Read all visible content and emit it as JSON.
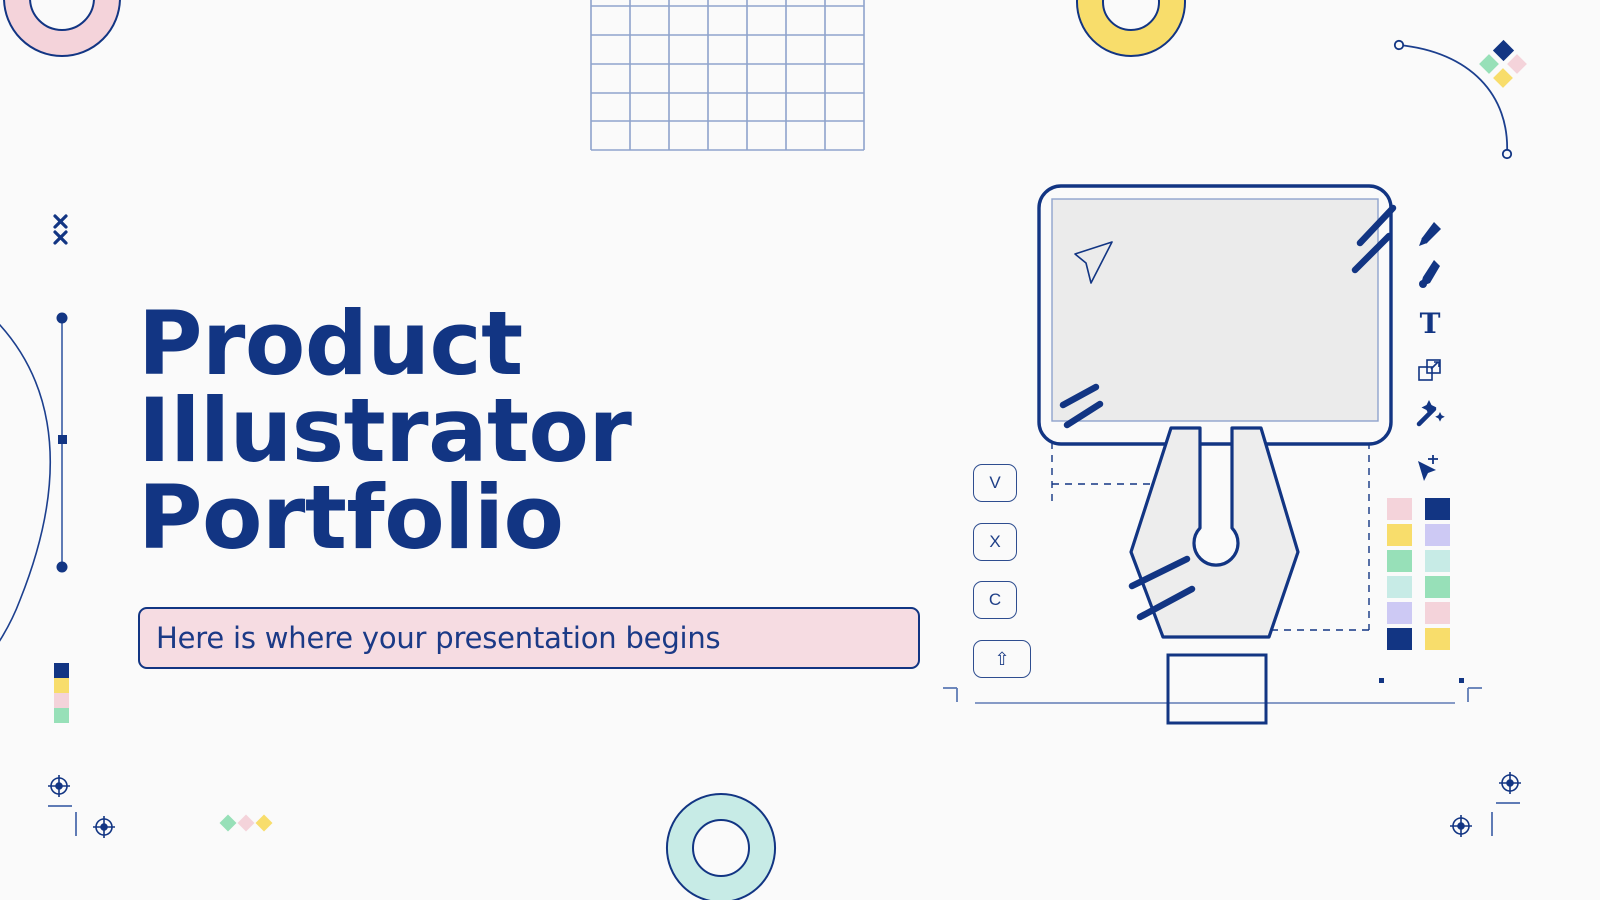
{
  "slide": {
    "title": "Product Illustrator\nPortfolio",
    "subtitle": "Here is where your presentation begins",
    "background_color": "#fafafa"
  },
  "palette": {
    "navy": "#123583",
    "navy_line": "#1c3f8e",
    "pink": "#f4d3da",
    "pink_soft": "#f6dce2",
    "yellow": "#f8dd6b",
    "green": "#97e0b8",
    "mint": "#c7ebe6",
    "lavender": "#cdc9f4",
    "screen_fill": "#ebebeb",
    "nib_fill": "#ededed"
  },
  "illustration": {
    "name": "illustrator-workspace",
    "screen": {
      "name": "tablet-screen",
      "cursor_icon": "cursor-arrow-icon",
      "shine_icon": "shine-lines-icon"
    },
    "pen_nib": {
      "name": "pen-nib-icon"
    },
    "keycaps": [
      {
        "label": "V",
        "name": "keycap-v"
      },
      {
        "label": "X",
        "name": "keycap-x"
      },
      {
        "label": "C",
        "name": "keycap-c"
      },
      {
        "label": "⇧",
        "name": "keycap-shift"
      }
    ],
    "toolbar": [
      {
        "name": "pen-tool-icon",
        "label": "Pen tool"
      },
      {
        "name": "paintbrush-tool-icon",
        "label": "Paintbrush tool"
      },
      {
        "name": "type-tool-icon",
        "label": "T"
      },
      {
        "name": "scale-tool-icon",
        "label": "Scale tool"
      },
      {
        "name": "magic-wand-tool-icon",
        "label": "Magic wand tool"
      },
      {
        "name": "direct-selection-add-icon",
        "label": "Direct selection add"
      }
    ],
    "swatch_grid": {
      "columns": 2,
      "rows": 6,
      "colors": [
        [
          "#f4d3da",
          "#123583"
        ],
        [
          "#f8dd6b",
          "#cdc9f4"
        ],
        [
          "#97e0b8",
          "#c7ebe6"
        ],
        [
          "#c7ebe6",
          "#97e0b8"
        ],
        [
          "#cdc9f4",
          "#f4d3da"
        ],
        [
          "#123583",
          "#f8dd6b"
        ]
      ]
    }
  },
  "decorations": {
    "grid_top": {
      "name": "top-grid",
      "columns": 8,
      "rows": 5
    },
    "ring_top_left": {
      "name": "pink-ring",
      "color": "#f4d3da"
    },
    "ring_top_right": {
      "name": "yellow-ring",
      "color": "#f8dd6b"
    },
    "ring_bottom": {
      "name": "mint-ring",
      "color": "#c7ebe6"
    },
    "x_marks": {
      "name": "x-marks-icon",
      "count": 2
    },
    "bezier_left": {
      "name": "bezier-anchor-handles"
    },
    "bezier_top_right": {
      "name": "bezier-curve-path"
    },
    "diamond_cluster": {
      "name": "diamond-cluster",
      "colors": [
        "#123583",
        "#97e0b8",
        "#f4d3da",
        "#f8dd6b"
      ]
    },
    "diamond_row": {
      "name": "diamond-row",
      "colors": [
        "#97e0b8",
        "#f4d3da",
        "#f8dd6b"
      ]
    },
    "mini_strip": {
      "name": "mini-color-strip",
      "colors": [
        "#123583",
        "#f8dd6b",
        "#f4d3da",
        "#97e0b8"
      ]
    },
    "registration_marks": {
      "name": "registration-mark-icon",
      "count": 4
    }
  }
}
